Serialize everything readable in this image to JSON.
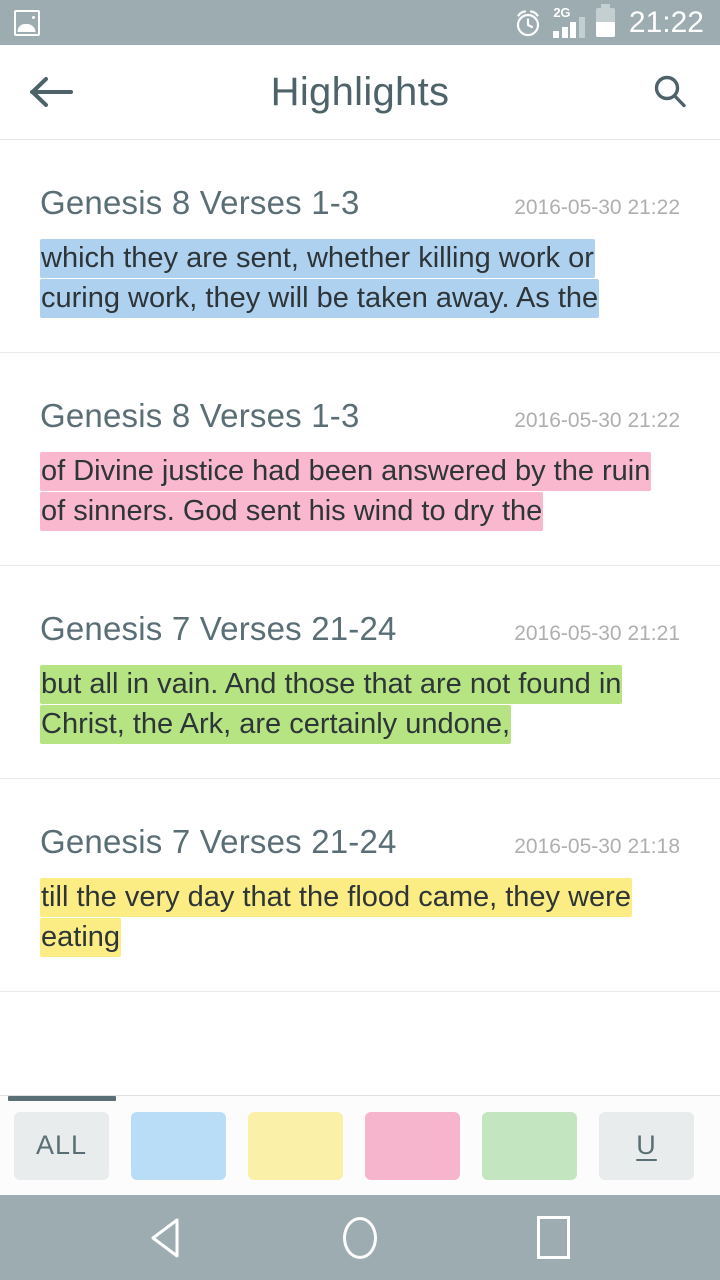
{
  "status_bar": {
    "notification_icon": "photo-icon",
    "alarm_icon": "alarm-icon",
    "network_type": "2G",
    "signal_icon": "signal-bars-icon",
    "battery_icon": "battery-icon",
    "time": "21:22",
    "background_color": "#9CACB0"
  },
  "app_bar": {
    "back_icon": "back-arrow-icon",
    "title": "Highlights",
    "search_icon": "search-icon",
    "title_color": "#4D6369"
  },
  "highlights": [
    {
      "verse": "Genesis 8 Verses 1-3",
      "date": "2016-05-30 21:22",
      "text": "which they are sent, whether killing work or curing work, they will be taken away. As the",
      "color_name": "blue",
      "color": "#AFD1F0"
    },
    {
      "verse": "Genesis 8 Verses 1-3",
      "date": "2016-05-30 21:22",
      "text": "of Divine justice had been answered by the ruin of sinners. God sent his wind to dry the",
      "color_name": "pink",
      "color": "#FAB8CE"
    },
    {
      "verse": "Genesis 7 Verses 21-24",
      "date": "2016-05-30 21:21",
      "text": "but all in vain. And those that are not found in Christ, the Ark, are certainly undone,",
      "color_name": "green",
      "color": "#B6E483"
    },
    {
      "verse": "Genesis 7 Verses 21-24",
      "date": "2016-05-30 21:18",
      "text": "till the very day that the flood came, they were eating",
      "color_name": "yellow",
      "color": "#FBEC83"
    }
  ],
  "filter_bar": {
    "chips": [
      {
        "label": "ALL",
        "name": "filter-all",
        "color": "#E9ECEC",
        "is_text": true
      },
      {
        "label": "",
        "name": "filter-blue",
        "color": "#B9DCF7",
        "is_text": false
      },
      {
        "label": "",
        "name": "filter-yellow",
        "color": "#FAF0A8",
        "is_text": false
      },
      {
        "label": "",
        "name": "filter-pink",
        "color": "#F6B5CD",
        "is_text": false
      },
      {
        "label": "",
        "name": "filter-green",
        "color": "#C3E5C0",
        "is_text": false
      },
      {
        "label": "U",
        "name": "filter-underline",
        "color": "#E9ECEC",
        "is_text": true
      }
    ]
  },
  "nav_bar": {
    "back_label": "back-triangle-icon",
    "home_label": "home-circle-icon",
    "recents_label": "recents-square-icon",
    "background_color": "#9CACB0"
  }
}
